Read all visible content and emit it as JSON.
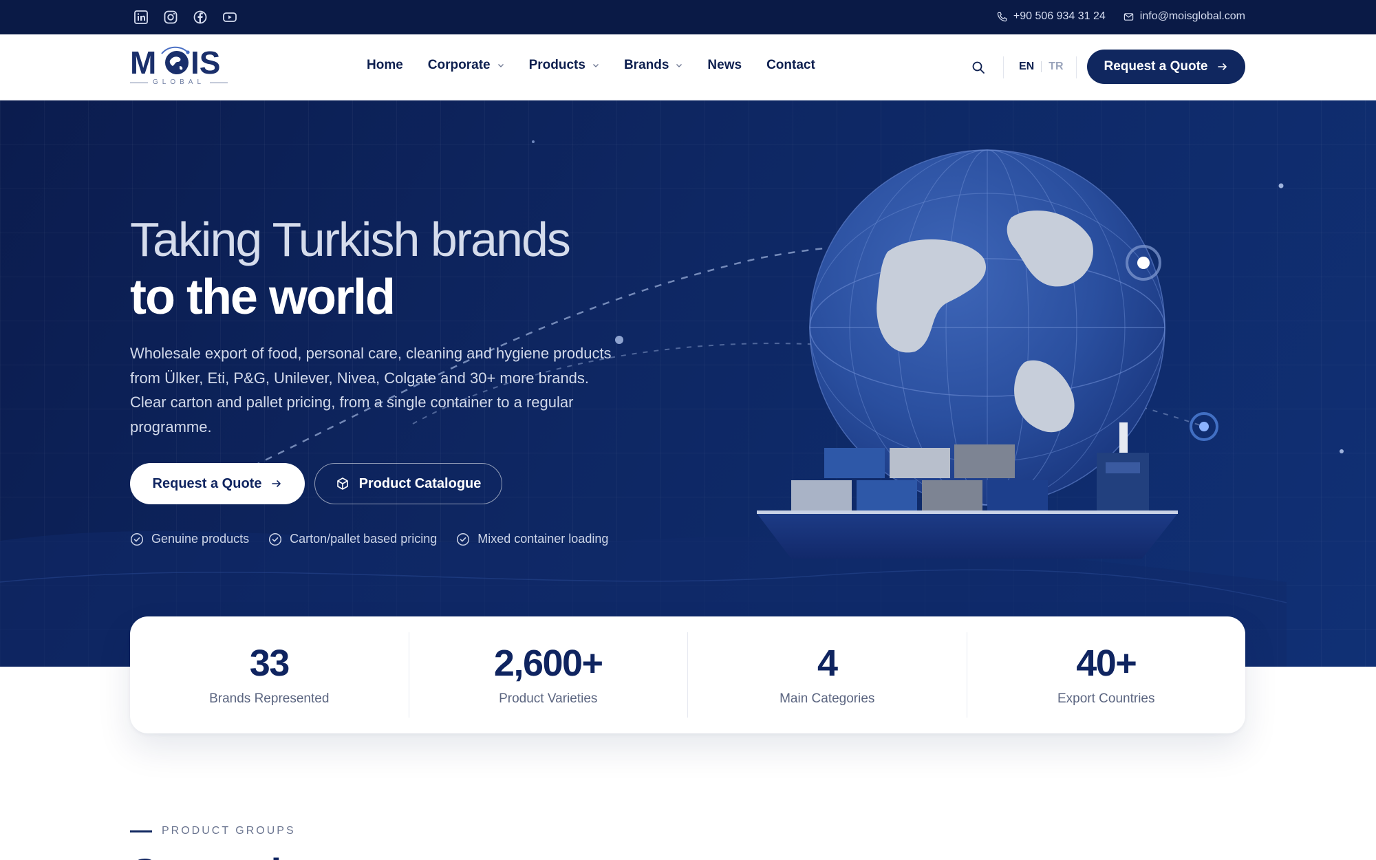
{
  "topbar": {
    "social": [
      "linkedin-icon",
      "instagram-icon",
      "facebook-icon",
      "youtube-icon"
    ],
    "phone": "+90 506 934 31 24",
    "email": "info@moisglobal.com"
  },
  "brand": {
    "logo_word": "MOIS",
    "logo_sub": "GLOBAL"
  },
  "nav": {
    "items": [
      {
        "label": "Home",
        "dropdown": false
      },
      {
        "label": "Corporate",
        "dropdown": true
      },
      {
        "label": "Products",
        "dropdown": true
      },
      {
        "label": "Brands",
        "dropdown": true
      },
      {
        "label": "News",
        "dropdown": false
      },
      {
        "label": "Contact",
        "dropdown": false
      }
    ],
    "lang_active": "EN",
    "lang_other": "TR",
    "cta": "Request a Quote"
  },
  "hero": {
    "title_line1": "Taking Turkish brands",
    "title_line2": "to the world",
    "lead": "Wholesale export of food, personal care, cleaning and hygiene products from Ülker, Eti, P&G, Unilever, Nivea, Colgate and 30+ more brands. Clear carton and pallet pricing, from a single container to a regular programme.",
    "primary_button": "Request a Quote",
    "secondary_button": "Product Catalogue",
    "features": [
      "Genuine products",
      "Carton/pallet based pricing",
      "Mixed container loading"
    ]
  },
  "stats": [
    {
      "value": "33",
      "label": "Brands Represented"
    },
    {
      "value": "2,600+",
      "label": "Product Varieties"
    },
    {
      "value": "4",
      "label": "Main Categories"
    },
    {
      "value": "40+",
      "label": "Export Countries"
    }
  ],
  "section": {
    "eyebrow": "PRODUCT GROUPS",
    "title": "Categories"
  },
  "colors": {
    "navy": "#0a1a46",
    "primary": "#10275f",
    "hero_bg": "#0e2763",
    "white": "#ffffff"
  }
}
